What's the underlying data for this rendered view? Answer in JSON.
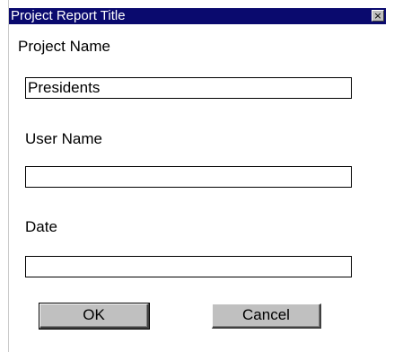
{
  "window": {
    "title": "Project Report Title",
    "close_glyph": "×",
    "close_icon": "close-icon"
  },
  "form": {
    "project_name": {
      "label": "Project Name",
      "value": "Presidents"
    },
    "user_name": {
      "label": "User Name",
      "value": ""
    },
    "date": {
      "label": "Date",
      "value": ""
    }
  },
  "buttons": {
    "ok_label": "OK",
    "cancel_label": "Cancel"
  },
  "colors": {
    "titlebar": "#0a0a6e",
    "button_face": "#c0c0c0"
  }
}
